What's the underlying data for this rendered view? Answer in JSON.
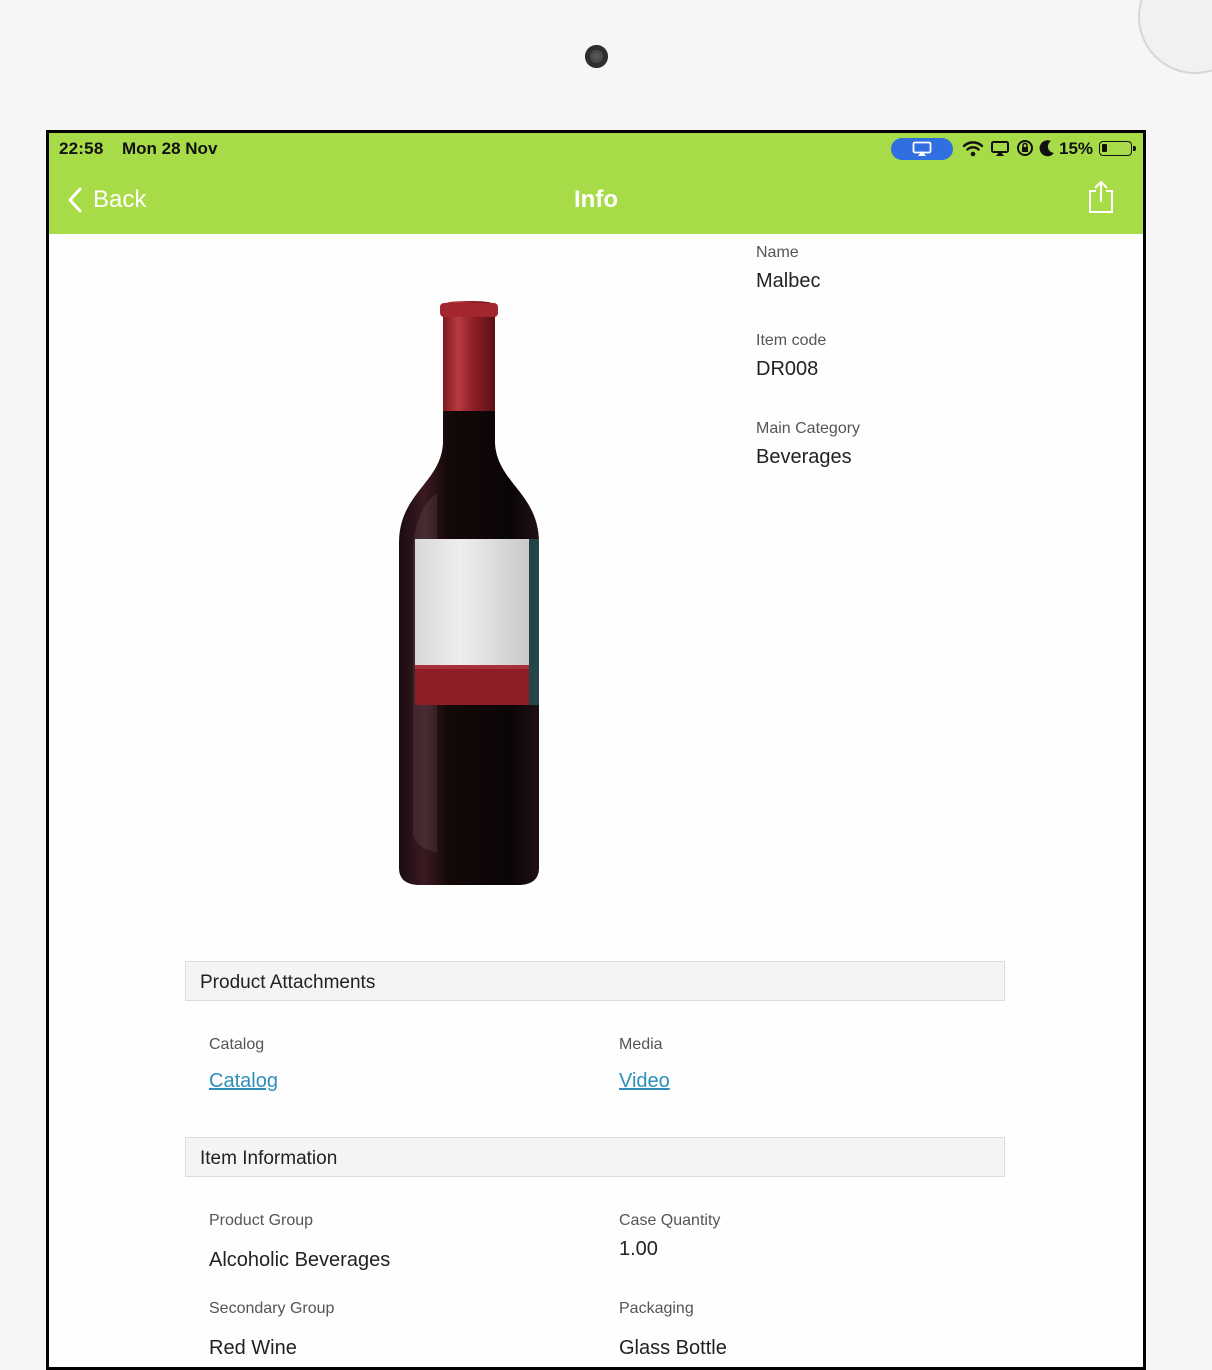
{
  "status_bar": {
    "time": "22:58",
    "date": "Mon 28 Nov",
    "battery_percent": "15%",
    "icons": [
      "airplay-icon",
      "wifi-icon",
      "screen-mirroring-icon",
      "rotation-lock-icon",
      "moon-icon",
      "battery-icon"
    ]
  },
  "nav": {
    "back_label": "Back",
    "title": "Info",
    "share_icon": "share-icon"
  },
  "product": {
    "image": "wine-bottle",
    "name_label": "Name",
    "name": "Malbec",
    "code_label": "Item code",
    "code": "DR008",
    "category_label": "Main Category",
    "category": "Beverages"
  },
  "attachments": {
    "title": "Product Attachments",
    "catalog_label": "Catalog",
    "catalog_link": "Catalog",
    "media_label": "Media",
    "media_link": "Video"
  },
  "item_info": {
    "title": "Item Information",
    "product_group_label": "Product Group",
    "product_group": "Alcoholic Beverages",
    "case_quantity_label": "Case Quantity",
    "case_quantity": "1.00",
    "secondary_group_label": "Secondary Group",
    "secondary_group": "Red Wine",
    "packaging_label": "Packaging",
    "packaging": "Glass Bottle"
  },
  "colors": {
    "header_green": "#a8db48",
    "link_blue": "#2d8fb8",
    "airplay_blue": "#2f6fe0"
  }
}
